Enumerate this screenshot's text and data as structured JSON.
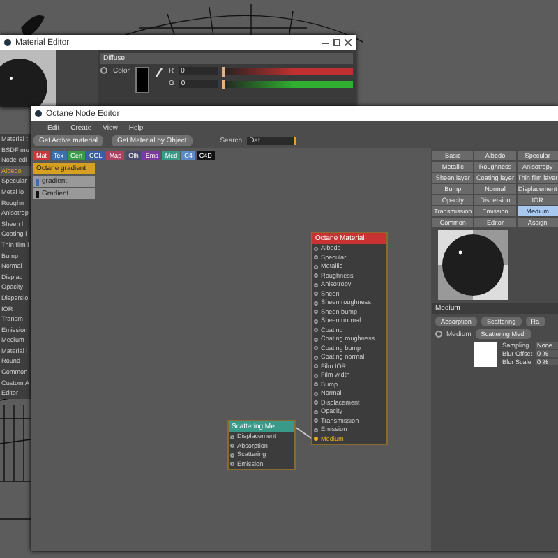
{
  "material_editor": {
    "title": "Material Editor",
    "section": "Diffuse",
    "color_label": "Color",
    "radio_checked": false,
    "channels": [
      {
        "name": "R",
        "value": "0",
        "level": 0,
        "color": "#c03030"
      },
      {
        "name": "G",
        "value": "0",
        "level": 0,
        "color": "#30b030"
      }
    ]
  },
  "side_panel": {
    "items": [
      {
        "label": "Material t",
        "selected": false
      },
      {
        "label": "BSDF mo",
        "selected": false
      },
      {
        "label": "Node edi",
        "selected": false
      },
      {
        "label": "Albedo",
        "selected": true
      },
      {
        "label": "Specular",
        "selected": false
      },
      {
        "label": "Metal lo",
        "selected": false
      },
      {
        "label": "Roughn",
        "selected": false
      },
      {
        "label": "Anisotrop",
        "selected": false
      },
      {
        "label": "Sheen l",
        "selected": false
      },
      {
        "label": "Coating l",
        "selected": false
      },
      {
        "label": "Thin film l",
        "selected": false
      },
      {
        "label": "Bump",
        "selected": false
      },
      {
        "label": "Normal",
        "selected": false
      },
      {
        "label": "Displac",
        "selected": false
      },
      {
        "label": "Opacity",
        "selected": false
      },
      {
        "label": "Dispersio",
        "selected": false
      },
      {
        "label": "IOR",
        "selected": false
      },
      {
        "label": "Transm",
        "selected": false
      },
      {
        "label": "Emission",
        "selected": false
      },
      {
        "label": "Medium",
        "selected": false
      },
      {
        "label": "Material l",
        "selected": false
      },
      {
        "label": "Round",
        "selected": false
      },
      {
        "label": "Common",
        "selected": false
      },
      {
        "label": "Custom A",
        "selected": false
      },
      {
        "label": "Editor",
        "selected": false
      }
    ]
  },
  "node_editor": {
    "title": "Octane Node Editor",
    "menu": [
      "Edit",
      "Create",
      "View",
      "Help"
    ],
    "buttons": [
      "Get Active material",
      "Get Material by Object"
    ],
    "search": {
      "label": "Search",
      "value": "Dat"
    },
    "categories": [
      {
        "label": "Mat",
        "color": "#c8393b"
      },
      {
        "label": "Tex",
        "color": "#3a6fb0"
      },
      {
        "label": "Gen",
        "color": "#3a9a4a"
      },
      {
        "label": "COL",
        "color": "#3b5fa0"
      },
      {
        "label": "Map",
        "color": "#b04060"
      },
      {
        "label": "Oth",
        "color": "#4a4a6a"
      },
      {
        "label": "Ems",
        "color": "#7a3aa0"
      },
      {
        "label": "Med",
        "color": "#3a9a8a"
      },
      {
        "label": "C4",
        "color": "#5a8ac8"
      },
      {
        "label": "C4D",
        "color": "#111111"
      }
    ],
    "results": [
      {
        "label": "Octane gradient",
        "selected": true
      },
      {
        "label": "gradient",
        "selected": false,
        "color": "#3a6fb0"
      },
      {
        "label": "Gradient",
        "selected": false,
        "color": "#111111"
      }
    ],
    "nodes": [
      {
        "title": "Octane Material",
        "color": "#c83232",
        "pins": [
          {
            "label": "Albedo",
            "connected": false
          },
          {
            "label": "Specular",
            "connected": false
          },
          {
            "label": "Metallic",
            "connected": false
          },
          {
            "label": "Roughness",
            "connected": false
          },
          {
            "label": "Anisotropy",
            "connected": false
          },
          {
            "label": "Sheen",
            "connected": false
          },
          {
            "label": "Sheen roughness",
            "connected": false
          },
          {
            "label": "Sheen bump",
            "connected": false
          },
          {
            "label": "Sheen normal",
            "connected": false
          },
          {
            "label": "Coating",
            "connected": false
          },
          {
            "label": "Coating roughness",
            "connected": false
          },
          {
            "label": "Coating bump",
            "connected": false
          },
          {
            "label": "Coating normal",
            "connected": false
          },
          {
            "label": "Film IOR",
            "connected": false
          },
          {
            "label": "Film width",
            "connected": false
          },
          {
            "label": "Bump",
            "connected": false
          },
          {
            "label": "Normal",
            "connected": false
          },
          {
            "label": "Displacement",
            "connected": false
          },
          {
            "label": "Opacity",
            "connected": false
          },
          {
            "label": "Transmission",
            "connected": false
          },
          {
            "label": "Emission",
            "connected": false
          },
          {
            "label": "Medium",
            "connected": true
          }
        ]
      },
      {
        "title": "Scattering Me",
        "color": "#3a9a8a",
        "pins": [
          {
            "label": "Displacement",
            "connected": false
          },
          {
            "label": "Absorption",
            "connected": false
          },
          {
            "label": "Scattering",
            "connected": false
          },
          {
            "label": "Emission",
            "connected": false
          }
        ]
      }
    ]
  },
  "material_panel": {
    "tabs": [
      {
        "label": "Basic",
        "selected": false
      },
      {
        "label": "Albedo",
        "selected": false
      },
      {
        "label": "Specular",
        "selected": false
      },
      {
        "label": "Metallic",
        "selected": false
      },
      {
        "label": "Roughness",
        "selected": false
      },
      {
        "label": "Anisotropy",
        "selected": false
      },
      {
        "label": "Sheen layer",
        "selected": false
      },
      {
        "label": "Coating layer",
        "selected": false
      },
      {
        "label": "Thin film layer",
        "selected": false
      },
      {
        "label": "Bump",
        "selected": false
      },
      {
        "label": "Normal",
        "selected": false
      },
      {
        "label": "Displacement",
        "selected": false
      },
      {
        "label": "Opacity",
        "selected": false
      },
      {
        "label": "Dispersion",
        "selected": false
      },
      {
        "label": "IOR",
        "selected": false
      },
      {
        "label": "Transmission",
        "selected": false
      },
      {
        "label": "Emission",
        "selected": false
      },
      {
        "label": "Medium",
        "selected": true
      },
      {
        "label": "Common",
        "selected": false
      },
      {
        "label": "Editor",
        "selected": false
      },
      {
        "label": "Assign",
        "selected": false
      }
    ],
    "medium": {
      "title": "Medium",
      "buttons": [
        "Absorption",
        "Scattering",
        "Ra"
      ],
      "medium_label": "Medium",
      "radio_checked": false,
      "medium_button": "Scattering Medi",
      "fields": [
        {
          "label": "Sampling",
          "value": "None"
        },
        {
          "label": "Blur Offset",
          "value": "0 %"
        },
        {
          "label": "Blur Scale",
          "value": "0 %"
        }
      ]
    }
  }
}
